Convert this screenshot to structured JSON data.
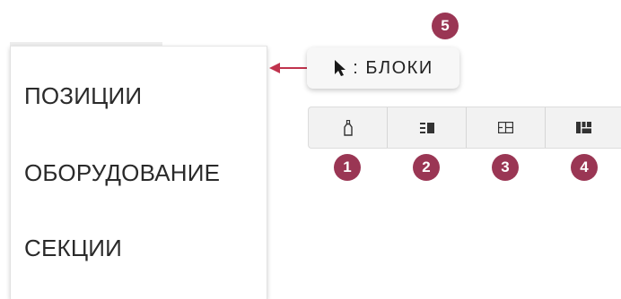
{
  "menu": {
    "items": [
      {
        "label": "ПОЗИЦИИ"
      },
      {
        "label": "ОБОРУДОВАНИЕ"
      },
      {
        "label": "СЕКЦИИ"
      }
    ]
  },
  "tooltip": {
    "text": ": БЛОКИ",
    "icon": "cursor-pointer-icon"
  },
  "toolbar": {
    "buttons": [
      {
        "icon": "bottle-icon"
      },
      {
        "icon": "list-block-icon"
      },
      {
        "icon": "grid-block-icon"
      },
      {
        "icon": "mosaic-block-icon"
      }
    ]
  },
  "callouts": [
    "1",
    "2",
    "3",
    "4",
    "5"
  ],
  "colors": {
    "badge": "#9a3654",
    "arrow": "#c0334d"
  }
}
